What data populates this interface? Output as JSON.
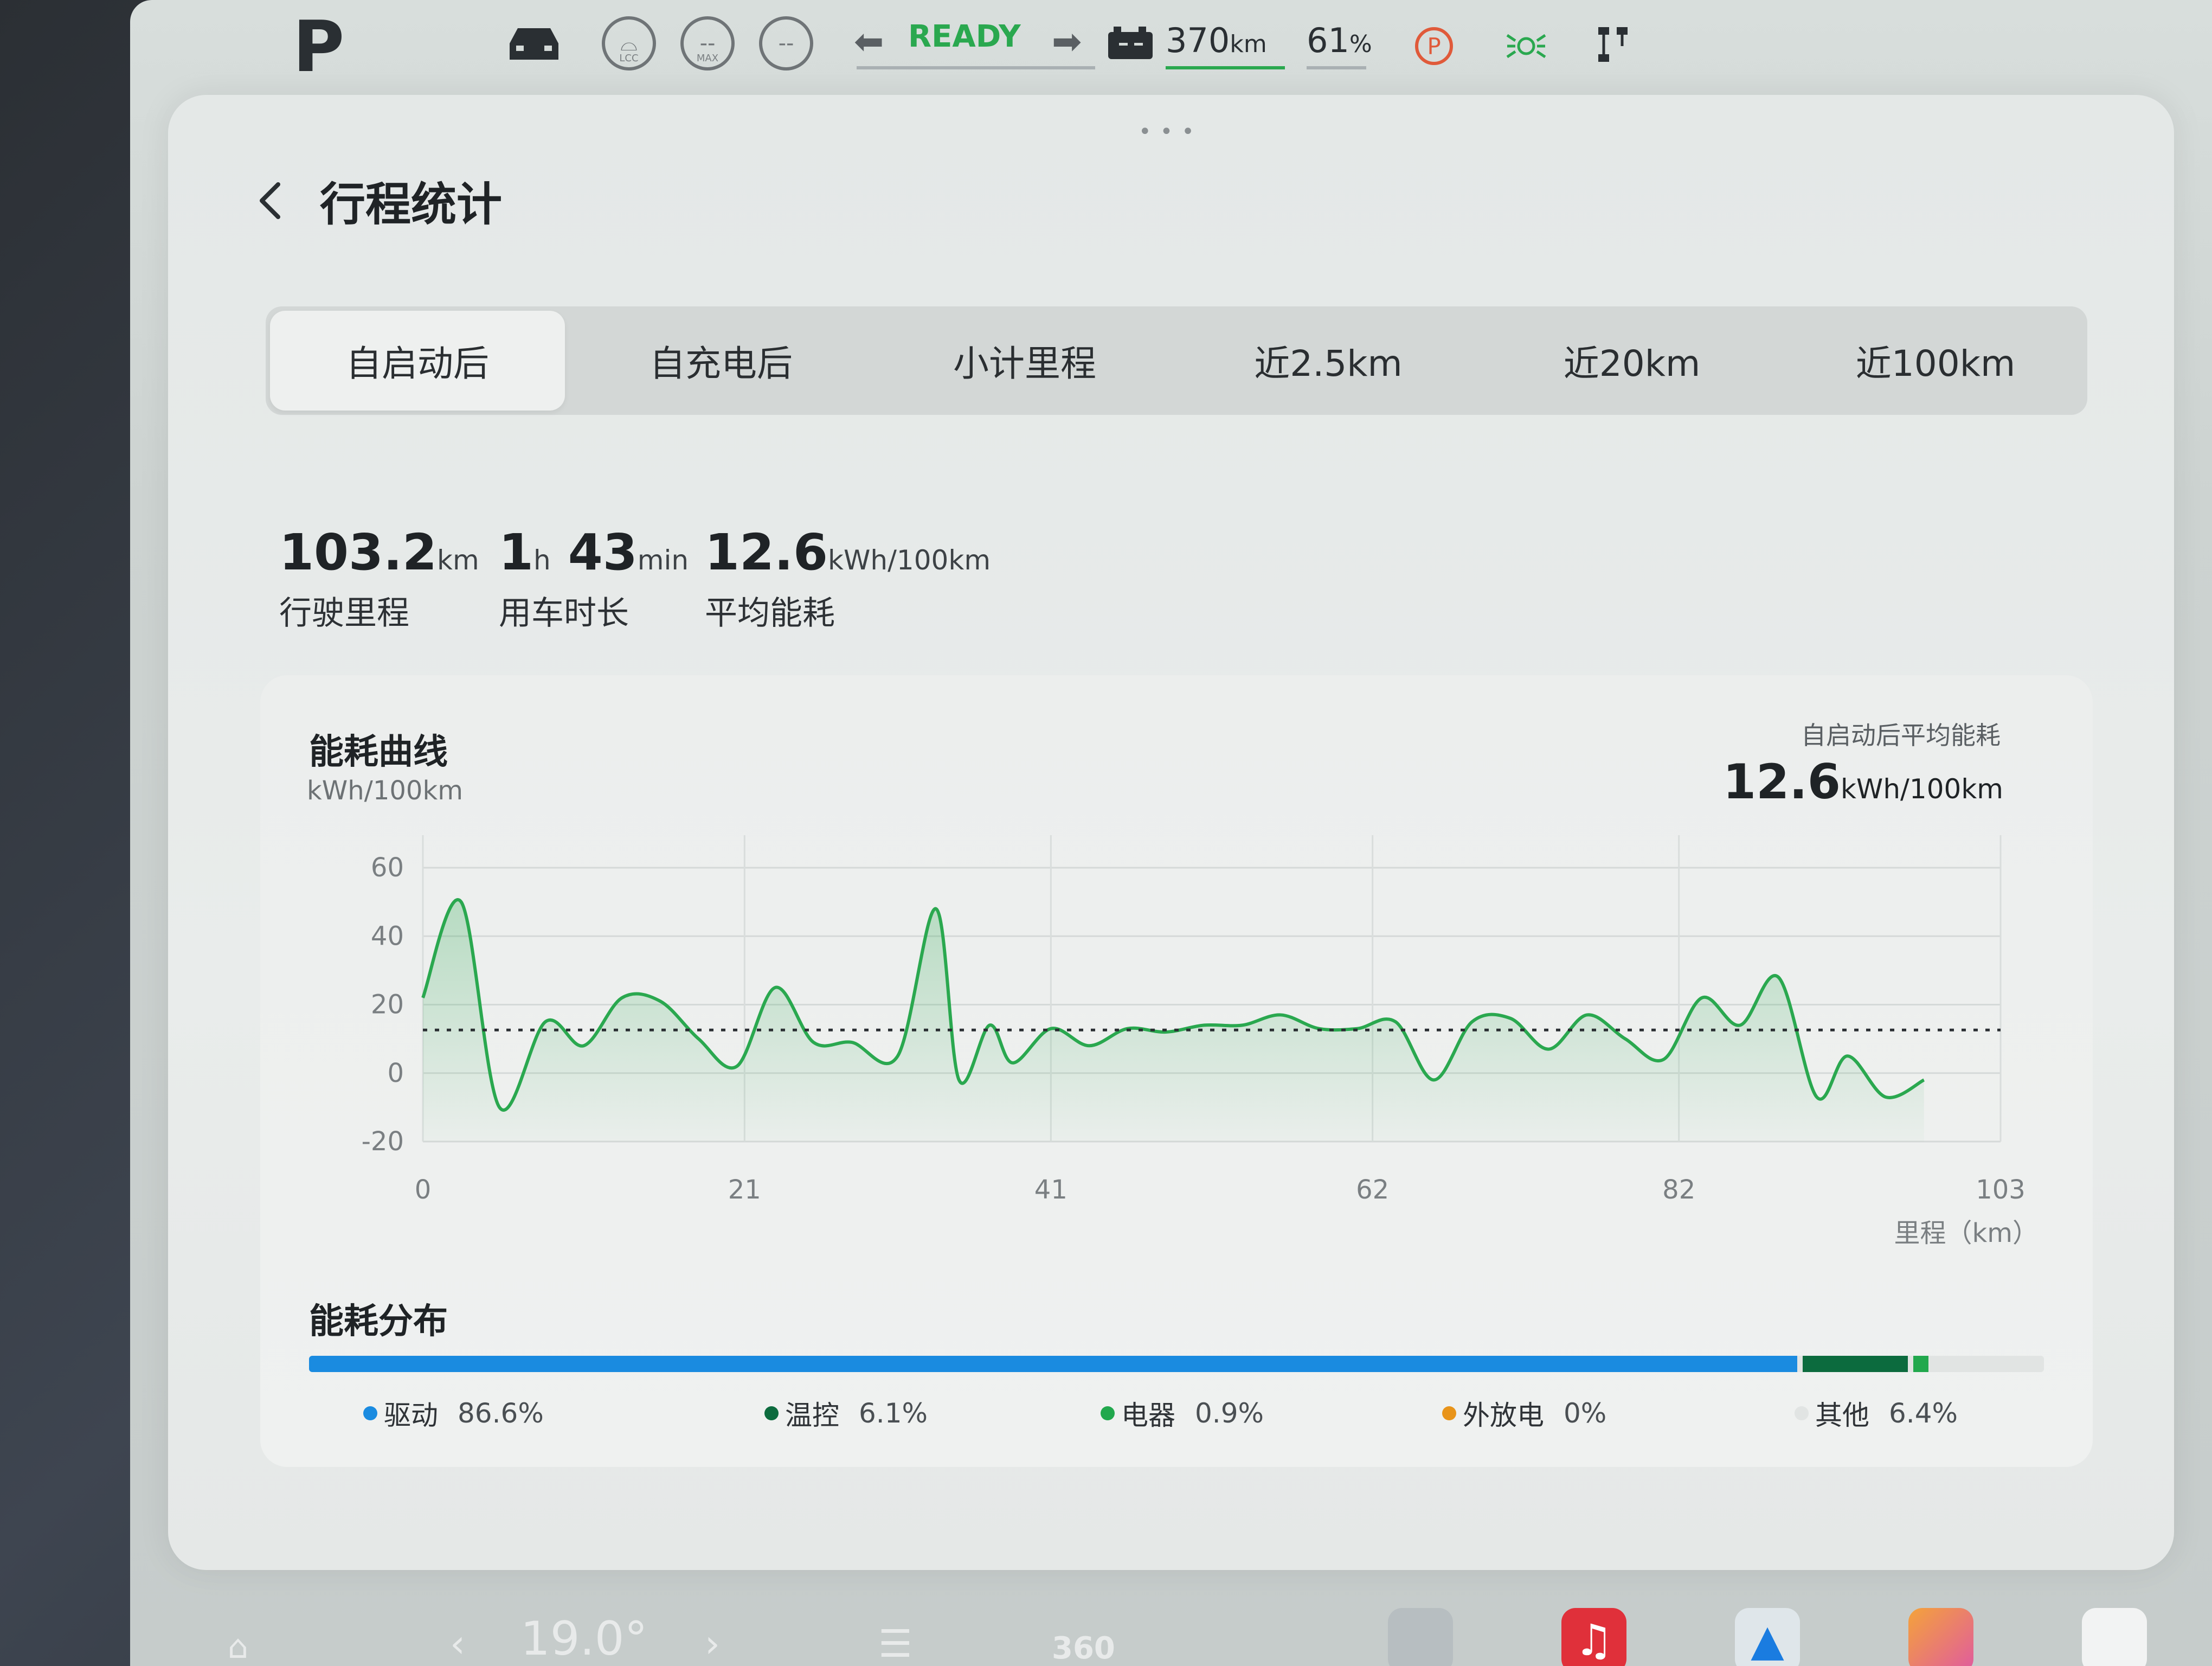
{
  "status_bar": {
    "gear": "P",
    "lcc_label": "LCC",
    "max_label": "MAX",
    "circle_placeholder": "--",
    "ready": "READY",
    "range_value": "370",
    "range_unit": "km",
    "battery_value": "61",
    "battery_unit": "%"
  },
  "page": {
    "title": "行程统计",
    "tabs": [
      {
        "label": "自启动后",
        "active": true
      },
      {
        "label": "自充电后",
        "active": false
      },
      {
        "label": "小计里程",
        "active": false
      },
      {
        "label": "近2.5km",
        "active": false
      },
      {
        "label": "近20km",
        "active": false
      },
      {
        "label": "近100km",
        "active": false
      }
    ]
  },
  "stats": {
    "distance": {
      "value": "103.2",
      "unit": "km",
      "label": "行驶里程"
    },
    "duration": {
      "hours": "1",
      "h_unit": "h",
      "minutes": "43",
      "m_unit": "min",
      "label": "用车时长"
    },
    "avg_energy": {
      "value": "12.6",
      "unit": "kWh/100km",
      "label": "平均能耗"
    }
  },
  "chart": {
    "title": "能耗曲线",
    "unit": "kWh/100km",
    "avg_label": "自启动后平均能耗",
    "avg_value": "12.6",
    "avg_unit": "kWh/100km",
    "x_axis_label": "里程（km）"
  },
  "chart_data": {
    "type": "area",
    "title": "能耗曲线",
    "ylabel": "kWh/100km",
    "xlabel": "里程（km）",
    "ylim": [
      -20,
      60
    ],
    "xlim": [
      0,
      103
    ],
    "y_ticks": [
      60,
      40,
      20,
      0,
      -20
    ],
    "x_ticks": [
      0,
      21,
      41,
      62,
      82,
      103
    ],
    "average_line": 12.6,
    "line_color": "#2aa84f",
    "x": [
      0,
      2.5,
      5,
      8,
      10.5,
      13,
      15.5,
      18,
      20.5,
      23,
      25.5,
      28,
      31,
      33.5,
      35,
      37,
      38.5,
      41,
      43.5,
      46,
      48.5,
      51,
      53.5,
      56,
      58.5,
      61,
      63.5,
      66,
      68.5,
      71,
      73.5,
      76,
      78.5,
      81,
      83.5,
      86,
      88.5,
      91,
      93,
      95.5,
      98,
      100.5,
      103
    ],
    "y": [
      22,
      50,
      -10,
      15,
      8,
      22,
      21,
      10,
      2,
      25,
      9,
      9,
      5,
      48,
      -2,
      14,
      3,
      13,
      8,
      13,
      12,
      14,
      14,
      17,
      13,
      13,
      15,
      -2,
      15,
      16,
      7,
      17,
      10,
      4,
      22,
      14,
      28,
      -7,
      5,
      -7,
      -2
    ],
    "grid": true
  },
  "distribution": {
    "title": "能耗分布",
    "items": [
      {
        "name": "驱动",
        "pct": "86.6%",
        "value": 86.6,
        "color": "#1a8be0"
      },
      {
        "name": "温控",
        "pct": "6.1%",
        "value": 6.1,
        "color": "#0c6b3e"
      },
      {
        "name": "电器",
        "pct": "0.9%",
        "value": 0.9,
        "color": "#21a84d"
      },
      {
        "name": "外放电",
        "pct": "0%",
        "value": 0,
        "color": "#e8941a"
      },
      {
        "name": "其他",
        "pct": "6.4%",
        "value": 6.4,
        "color": "#e1e4e3"
      }
    ]
  },
  "dock": {
    "temperature": "19.0°",
    "view_360": "360"
  }
}
